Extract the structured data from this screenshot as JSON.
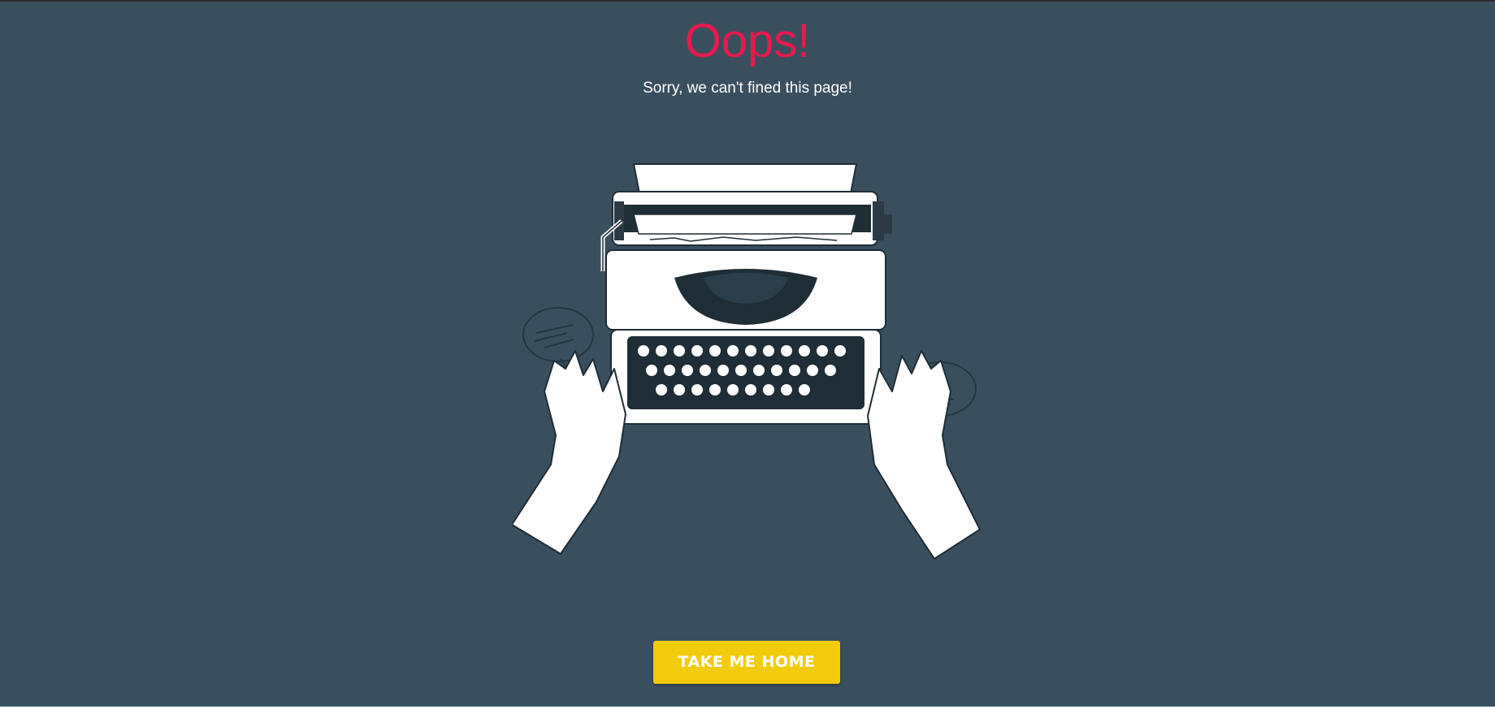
{
  "page": {
    "title": "Oops!",
    "subtitle": "Sorry, we can't fined this page!",
    "button_label": "TAKE ME HOME",
    "illustration": "typewriter-illustration"
  },
  "colors": {
    "background": "#3a4f5e",
    "title": "#e8194d",
    "subtitle": "#ffffff",
    "button": "#f2cc0c",
    "button_text": "#ffffff",
    "ink": "#1f2d36"
  }
}
